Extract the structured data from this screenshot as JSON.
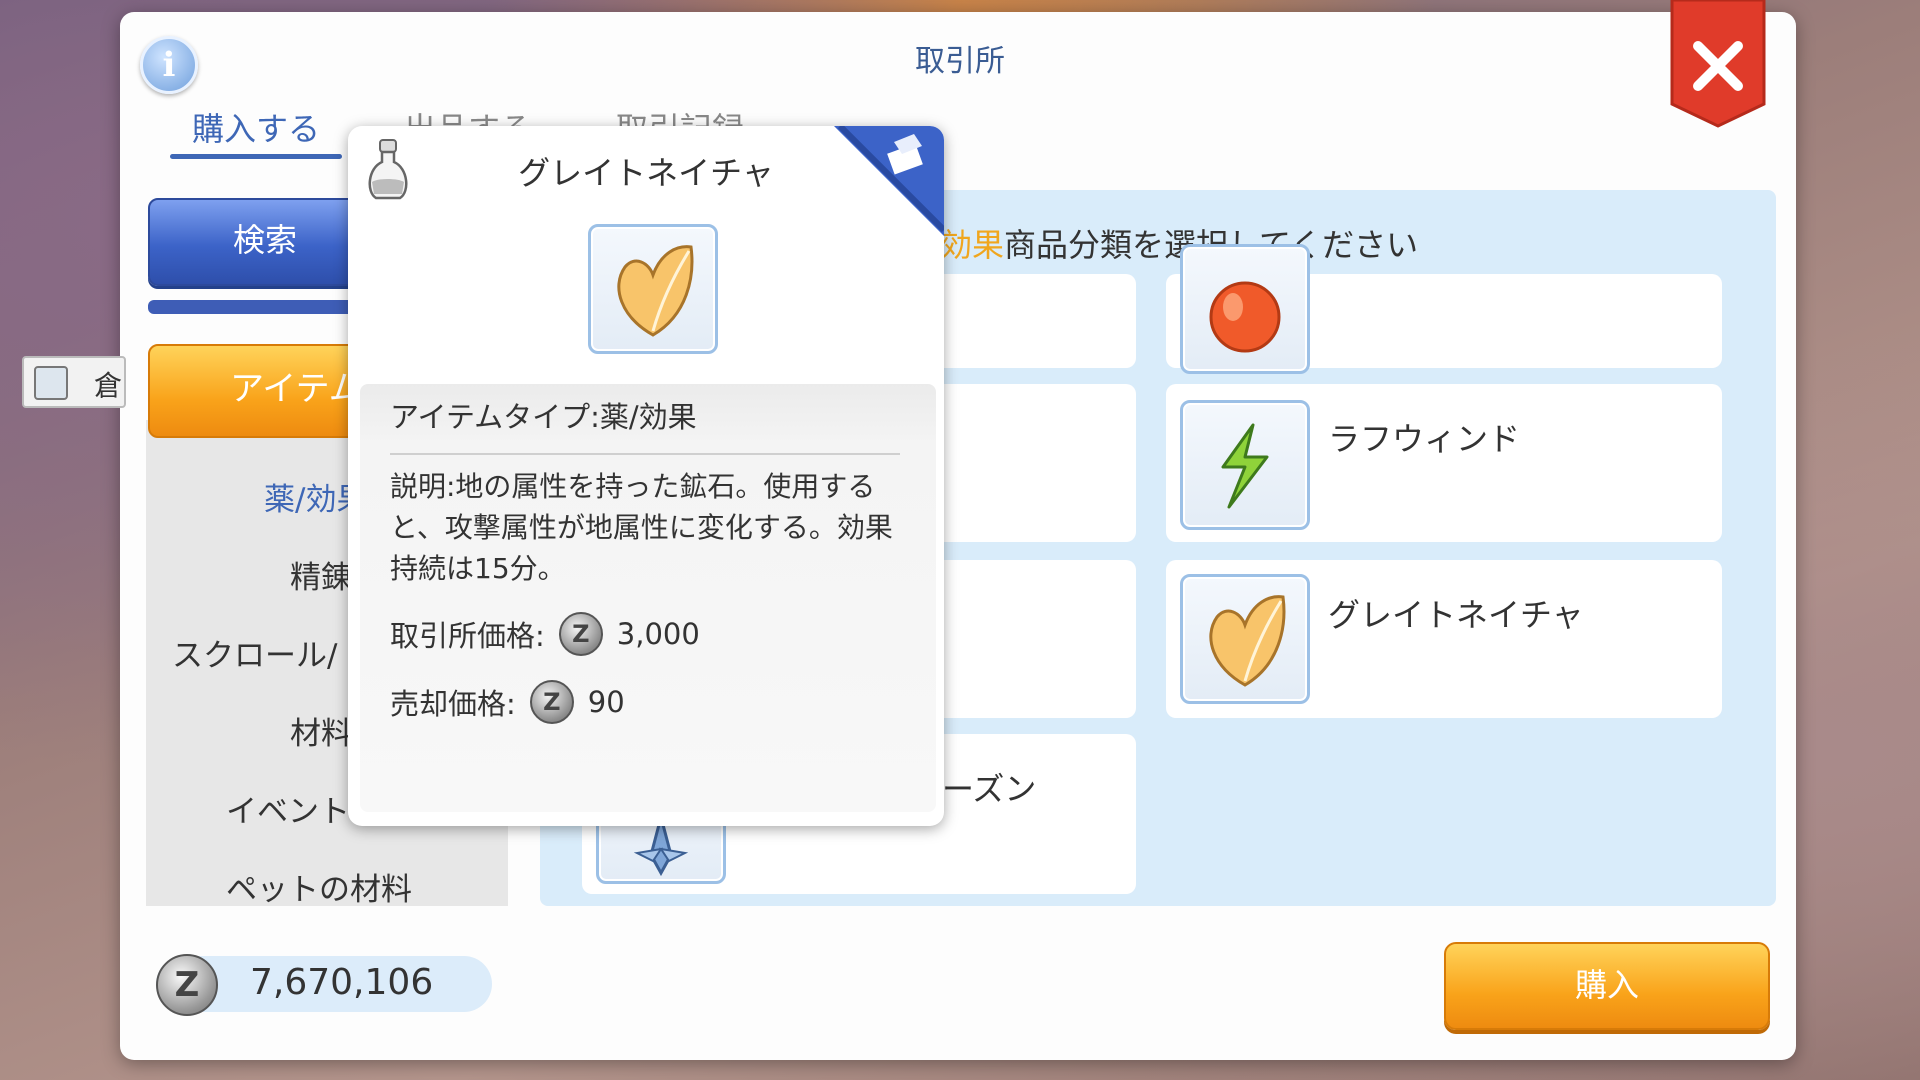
{
  "window": {
    "title": "取引所",
    "info_icon": "info-icon",
    "close_icon": "close-icon"
  },
  "tabs": [
    {
      "label": "購入する",
      "active": true
    },
    {
      "label": "出品する",
      "active": false
    },
    {
      "label": "取引記録",
      "active": false
    }
  ],
  "sidebar": {
    "search_label": "検索",
    "warehouse_label": "倉",
    "active_category": "アイテム",
    "categories": [
      "薬/効果",
      "精錬",
      "スクロール/",
      "材料",
      "イベント",
      "ペットの材料"
    ]
  },
  "list": {
    "header_accent": "効果",
    "header_text": "商品分類を選択してください",
    "items": [
      {
        "name": "",
        "icon": "apple-icon"
      },
      {
        "name": "ラフウィンド",
        "icon": "lightning-stone-icon"
      },
      {
        "name": "グレイトネイチャ",
        "icon": "leaf-stone-icon"
      },
      {
        "name": "ーズン",
        "icon": "crystal-icon"
      }
    ]
  },
  "tooltip": {
    "title": "グレイトネイチャ",
    "type_line": "アイテムタイプ:薬/効果",
    "description": "説明:地の属性を持った鉱石。使用すると、攻撃属性が地属性に変化する。効果持続は15分。",
    "exchange_price_label": "取引所価格:",
    "exchange_price": "3,000",
    "sell_price_label": "売却価格:",
    "sell_price": "90",
    "potion_icon": "potion-icon",
    "corner_icon": "box-icon"
  },
  "wallet": {
    "zeny": "7,670,106",
    "coin_glyph": "Z"
  },
  "buy_button": {
    "label": "購入"
  },
  "colors": {
    "accent_blue": "#3e67b6",
    "orange": "#f9a31a",
    "close_red": "#e03b2a"
  }
}
